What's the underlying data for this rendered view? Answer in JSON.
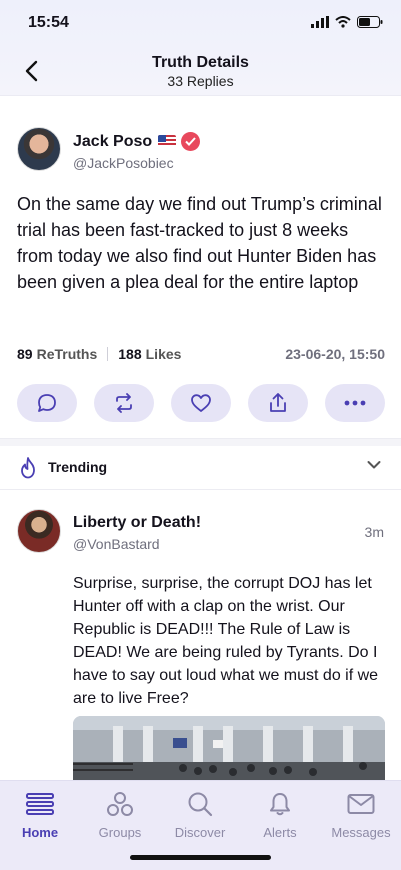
{
  "status_bar": {
    "time": "15:54"
  },
  "nav": {
    "title": "Truth Details",
    "subtitle": "33 Replies"
  },
  "post": {
    "author_name": "Jack Poso",
    "handle": "@JackPosobiec",
    "text": "On the same day we find out Trump’s criminal trial has been fast-tracked to just 8 weeks from today we also find out Hunter Biden has been given a plea deal for the entire laptop",
    "retruths_count": "89",
    "retruths_label": "ReTruths",
    "likes_count": "188",
    "likes_label": "Likes",
    "date": "23-06-20, 15:50"
  },
  "trending": {
    "label": "Trending"
  },
  "reply": {
    "author_name": "Liberty or Death!",
    "handle": "@VonBastard",
    "time": "3m",
    "text": "Surprise, surprise, the corrupt DOJ has let Hunter off with a clap on the wrist. Our Republic is DEAD!!! The Rule of Law is DEAD! We are being ruled by Tyrants. Do I have to say out loud what we must do if we are to live Free?"
  },
  "tabbar": {
    "home": "Home",
    "groups": "Groups",
    "discover": "Discover",
    "alerts": "Alerts",
    "messages": "Messages"
  },
  "colors": {
    "accent": "#4a3fb3",
    "action_bg": "#e6e4f6",
    "verified": "#e8485c"
  },
  "icons": [
    "chevron-left-icon",
    "signal-icon",
    "wifi-icon",
    "battery-icon",
    "verified-icon",
    "flag-icon",
    "reply-icon",
    "retruth-icon",
    "heart-icon",
    "share-icon",
    "more-icon",
    "flame-icon",
    "chevron-down-icon",
    "home-icon",
    "groups-icon",
    "search-icon",
    "bell-icon",
    "mail-icon"
  ]
}
